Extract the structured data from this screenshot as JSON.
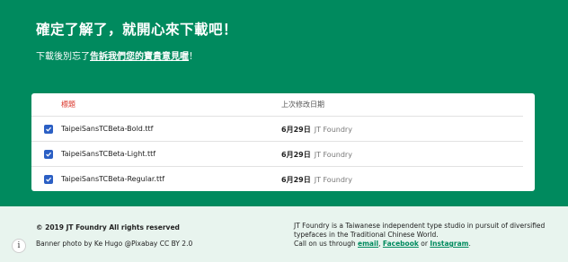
{
  "hero": {
    "title": "確定了解了，就開心來下載吧！",
    "subtitle_prefix": "下載後別忘了",
    "subtitle_link": "告訴我們您的寶貴意見喔",
    "subtitle_suffix": "！"
  },
  "table": {
    "headers": {
      "title": "標題",
      "modified": "上次修改日期"
    },
    "rows": [
      {
        "name": "TaipeiSansTCBeta-Bold.ttf",
        "date": "6月29日",
        "owner": "JT Foundry"
      },
      {
        "name": "TaipeiSansTCBeta-Light.ttf",
        "date": "6月29日",
        "owner": "JT Foundry"
      },
      {
        "name": "TaipeiSansTCBeta-Regular.ttf",
        "date": "6月29日",
        "owner": "JT Foundry"
      }
    ]
  },
  "footer": {
    "copyright": "© 2019 JT Foundry  All rights reserved",
    "banner_credit": "Banner photo by Ke Hugo @Pixabay CC BY 2.0",
    "about": "JT Foundry is a Taiwanese independent type studio in pursuit of diversified typefaces in the Traditional Chinese World.",
    "contact_prefix": "Call on us through ",
    "link_email": "email",
    "sep1": ", ",
    "link_facebook": "Facebook",
    "sep2": " or ",
    "link_instagram": "Instagram",
    "contact_suffix": ".",
    "info_glyph": "i"
  },
  "colors": {
    "brand_green": "#008a5e",
    "footer_bg": "#e8f4ee",
    "header_red": "#d93025",
    "checkbox_blue": "#2b5fc4"
  },
  "icons": {
    "checkbox": "checkbox-checked-icon",
    "info": "info-icon"
  }
}
